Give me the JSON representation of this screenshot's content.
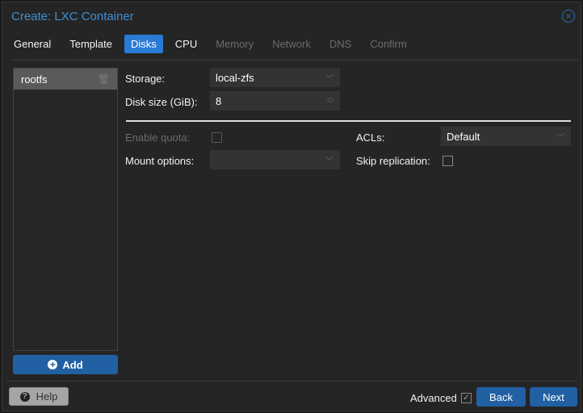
{
  "window": {
    "title": "Create: LXC Container"
  },
  "tabs": [
    {
      "label": "General",
      "state": "enabled"
    },
    {
      "label": "Template",
      "state": "enabled"
    },
    {
      "label": "Disks",
      "state": "active"
    },
    {
      "label": "CPU",
      "state": "enabled"
    },
    {
      "label": "Memory",
      "state": "disabled"
    },
    {
      "label": "Network",
      "state": "disabled"
    },
    {
      "label": "DNS",
      "state": "disabled"
    },
    {
      "label": "Confirm",
      "state": "disabled"
    }
  ],
  "disks": {
    "items": [
      {
        "label": "rootfs"
      }
    ],
    "add_label": "Add"
  },
  "form": {
    "storage": {
      "label": "Storage:",
      "value": "local-zfs"
    },
    "disk_size": {
      "label": "Disk size (GiB):",
      "value": "8"
    },
    "enable_quota": {
      "label": "Enable quota:",
      "checked": false
    },
    "mount_options": {
      "label": "Mount options:",
      "value": ""
    },
    "acls": {
      "label": "ACLs:",
      "value": "Default"
    },
    "skip_replication": {
      "label": "Skip replication:",
      "checked": false
    }
  },
  "footer": {
    "help_label": "Help",
    "advanced_label": "Advanced",
    "advanced_checked": true,
    "back_label": "Back",
    "next_label": "Next"
  }
}
